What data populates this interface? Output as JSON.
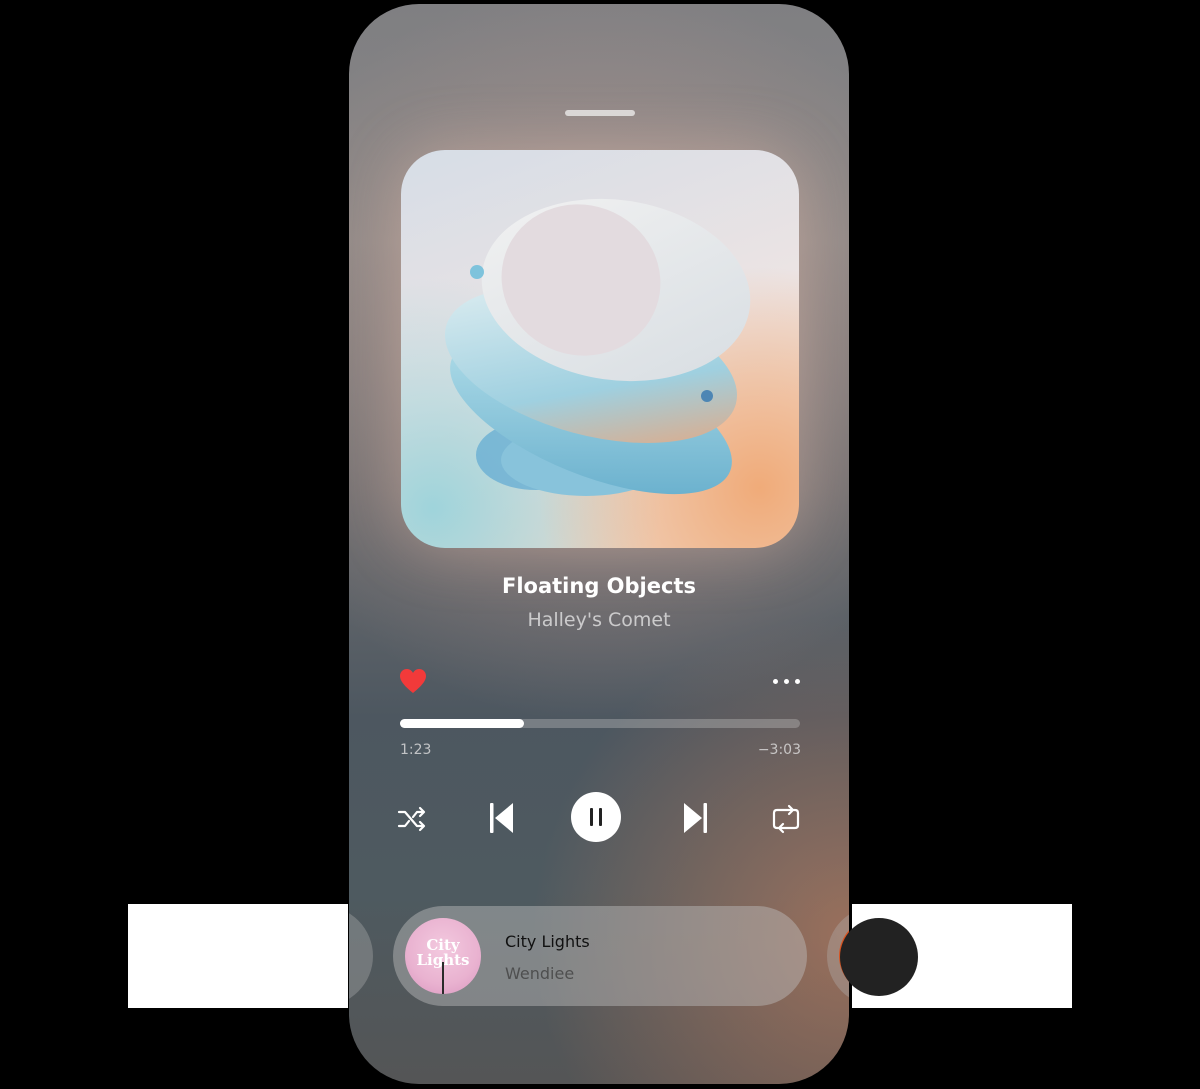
{
  "player": {
    "song_title": "Floating Objects",
    "artist": "Halley's Comet",
    "elapsed": "1:23",
    "remaining": "−3:03",
    "progress_fraction": 0.31,
    "liked": true,
    "icons": {
      "like": "heart-icon",
      "more": "more-options-icon",
      "shuffle": "shuffle-icon",
      "previous": "skip-previous-icon",
      "play_pause": "pause-icon",
      "next": "skip-next-icon",
      "repeat": "repeat-icon"
    }
  },
  "queue": {
    "current": {
      "title": "City Lights",
      "artist": "Wendiee",
      "thumb_text": "City Lights"
    }
  },
  "colors": {
    "heart": "#f23a3a",
    "progress_fill": "#ffffff",
    "accent_next_thumb": "#d9531f"
  }
}
